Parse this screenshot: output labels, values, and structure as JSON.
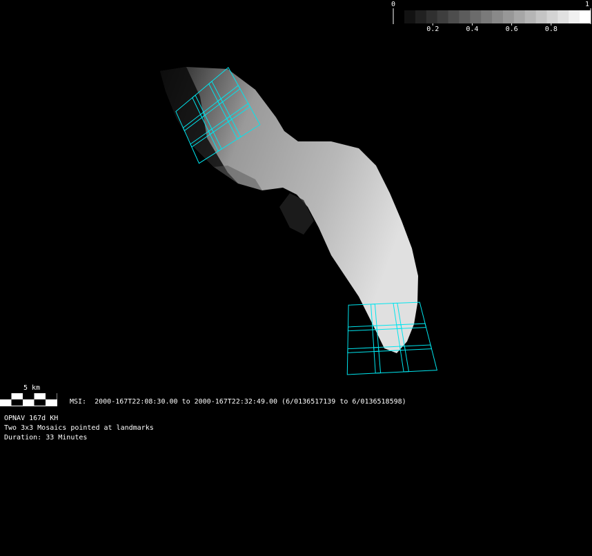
{
  "colorbar": {
    "min_label": "0",
    "max_label": "1",
    "tick_labels": [
      "0.2",
      "0.4",
      "0.6",
      "0.8"
    ],
    "tick_values": [
      0.2,
      0.4,
      0.6,
      0.8
    ],
    "steps": 17
  },
  "scale_bar": {
    "label": "5 km"
  },
  "observation": {
    "msi_line": "MSI:  2000-167T22:08:30.00 to 2000-167T22:32:49.00 (6/0136517139 to 6/0136518598)",
    "title": "OPNAV 167d KH",
    "description": "Two 3x3 Mosaics pointed at landmarks",
    "duration": "Duration: 33 Minutes"
  },
  "colors": {
    "footprint": "#00e5ee",
    "background": "#000000"
  }
}
